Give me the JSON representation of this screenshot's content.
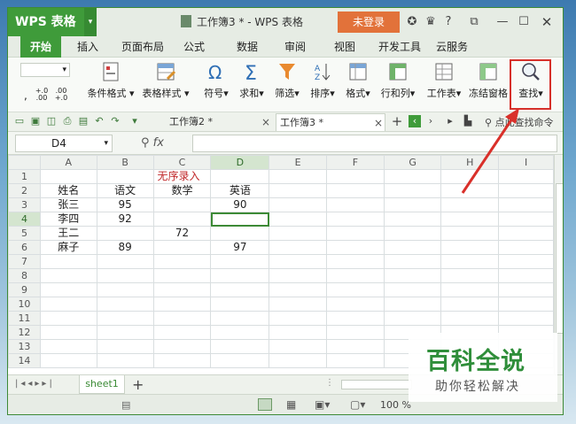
{
  "titlebar": {
    "app_label": "WPS 表格",
    "doc_title": "工作簿3 * - WPS 表格",
    "login_label": "未登录",
    "help_label": "?"
  },
  "menu": {
    "tabs": [
      "开始",
      "插入",
      "页面布局",
      "公式",
      "数据",
      "审阅",
      "视图",
      "开发工具",
      "云服务"
    ],
    "active": "开始"
  },
  "ribbon": {
    "fmt1": "+.0 .00",
    "fmt2": ".00 +.0",
    "fmt3": ",",
    "items": [
      "条件格式",
      "表格样式",
      "符号",
      "求和",
      "筛选",
      "排序",
      "格式",
      "行和列",
      "工作表",
      "冻结窗格",
      "查找"
    ]
  },
  "doc_tabs": {
    "tab1": "工作簿2 *",
    "tab2": "工作簿3 *",
    "search_placeholder": "点此查找命令"
  },
  "formula": {
    "cell_ref": "D4",
    "fx": "fx",
    "value": ""
  },
  "grid": {
    "columns": [
      "A",
      "B",
      "C",
      "D",
      "E",
      "F",
      "G",
      "H",
      "I"
    ],
    "rows": [
      {
        "n": "1",
        "cells": [
          "",
          "",
          "无序录入",
          "",
          "",
          "",
          "",
          "",
          ""
        ]
      },
      {
        "n": "2",
        "cells": [
          "姓名",
          "语文",
          "数学",
          "英语",
          "",
          "",
          "",
          "",
          ""
        ]
      },
      {
        "n": "3",
        "cells": [
          "张三",
          "95",
          "",
          "90",
          "",
          "",
          "",
          "",
          ""
        ]
      },
      {
        "n": "4",
        "cells": [
          "李四",
          "92",
          "",
          "",
          "",
          "",
          "",
          "",
          ""
        ]
      },
      {
        "n": "5",
        "cells": [
          "王二",
          "",
          "72",
          "",
          "",
          "",
          "",
          "",
          ""
        ]
      },
      {
        "n": "6",
        "cells": [
          "麻子",
          "89",
          "",
          "97",
          "",
          "",
          "",
          "",
          ""
        ]
      },
      {
        "n": "7",
        "cells": [
          "",
          "",
          "",
          "",
          "",
          "",
          "",
          "",
          ""
        ]
      },
      {
        "n": "8",
        "cells": [
          "",
          "",
          "",
          "",
          "",
          "",
          "",
          "",
          ""
        ]
      },
      {
        "n": "9",
        "cells": [
          "",
          "",
          "",
          "",
          "",
          "",
          "",
          "",
          ""
        ]
      },
      {
        "n": "10",
        "cells": [
          "",
          "",
          "",
          "",
          "",
          "",
          "",
          "",
          ""
        ]
      },
      {
        "n": "11",
        "cells": [
          "",
          "",
          "",
          "",
          "",
          "",
          "",
          "",
          ""
        ]
      },
      {
        "n": "12",
        "cells": [
          "",
          "",
          "",
          "",
          "",
          "",
          "",
          "",
          ""
        ]
      },
      {
        "n": "13",
        "cells": [
          "",
          "",
          "",
          "",
          "",
          "",
          "",
          "",
          ""
        ]
      },
      {
        "n": "14",
        "cells": [
          "",
          "",
          "",
          "",
          "",
          "",
          "",
          "",
          ""
        ]
      }
    ],
    "selected": "D4"
  },
  "sheets": {
    "tabs": [
      "sheet1"
    ],
    "add_label": "+"
  },
  "status": {
    "zoom": "100 %"
  },
  "watermark": {
    "title": "百科全说",
    "subtitle": "助你轻松解决"
  },
  "colors": {
    "brand": "#3f9b3a",
    "login": "#e2723a",
    "highlight": "#d6302a",
    "note": "#c0282a"
  }
}
